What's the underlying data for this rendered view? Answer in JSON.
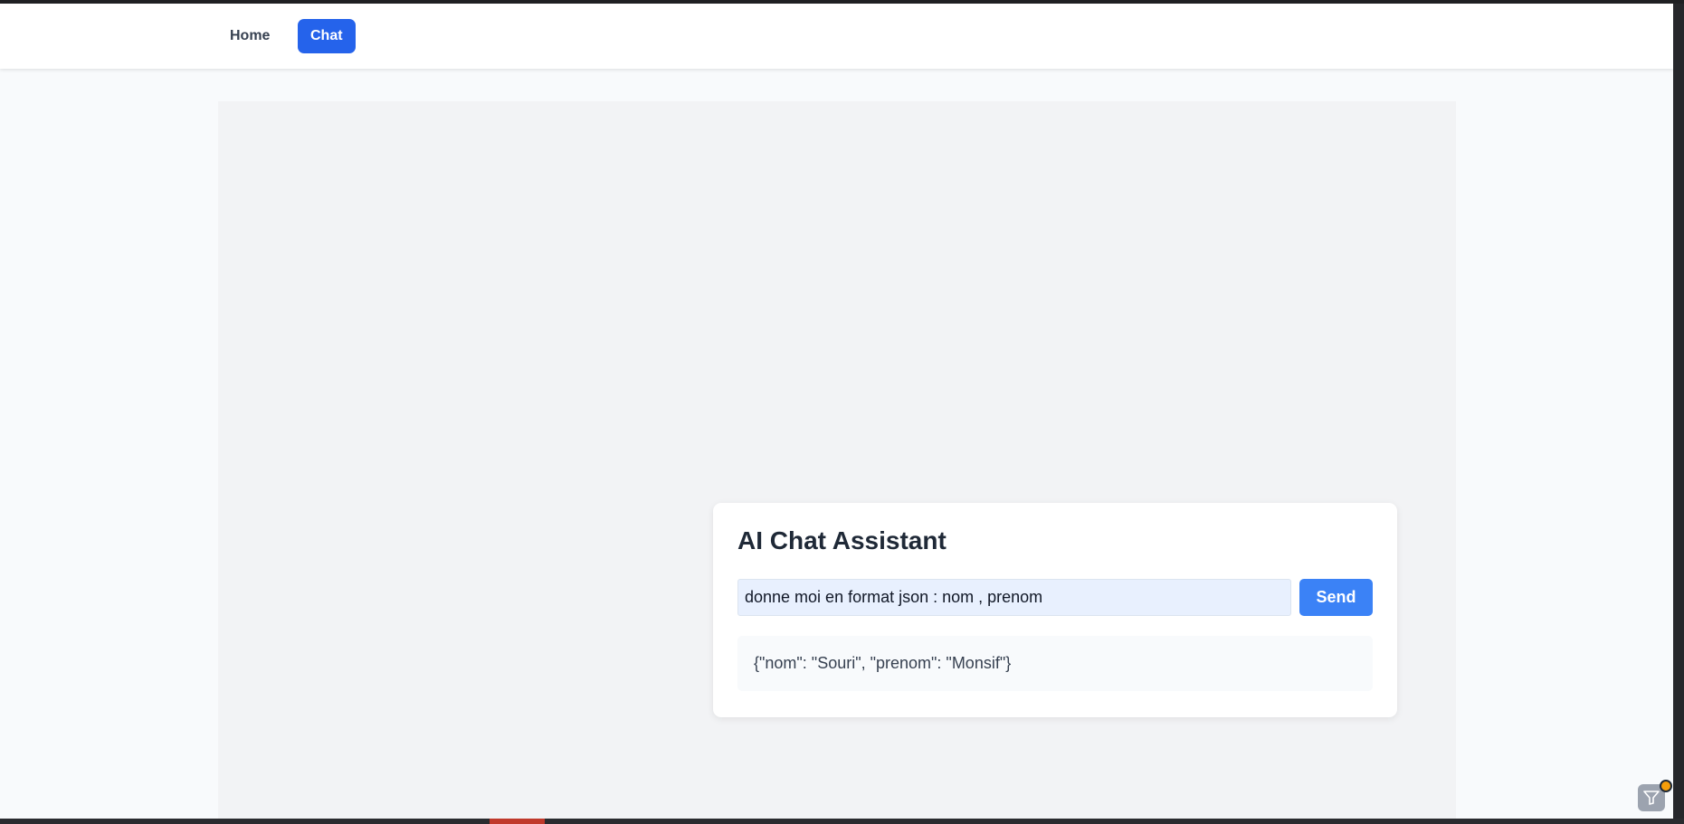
{
  "nav": {
    "items": [
      {
        "label": "Home",
        "active": false
      },
      {
        "label": "Chat",
        "active": true
      }
    ],
    "active_color": "#2563eb"
  },
  "chat": {
    "title": "AI Chat Assistant",
    "input_value": "donne moi en format json : nom , prenom",
    "send_label": "Send",
    "response": "{\"nom\": \"Souri\", \"prenom\": \"Monsif\"}"
  },
  "widget": {
    "icon": "filter-funnel-icon",
    "badge_color": "#f59e0b"
  }
}
